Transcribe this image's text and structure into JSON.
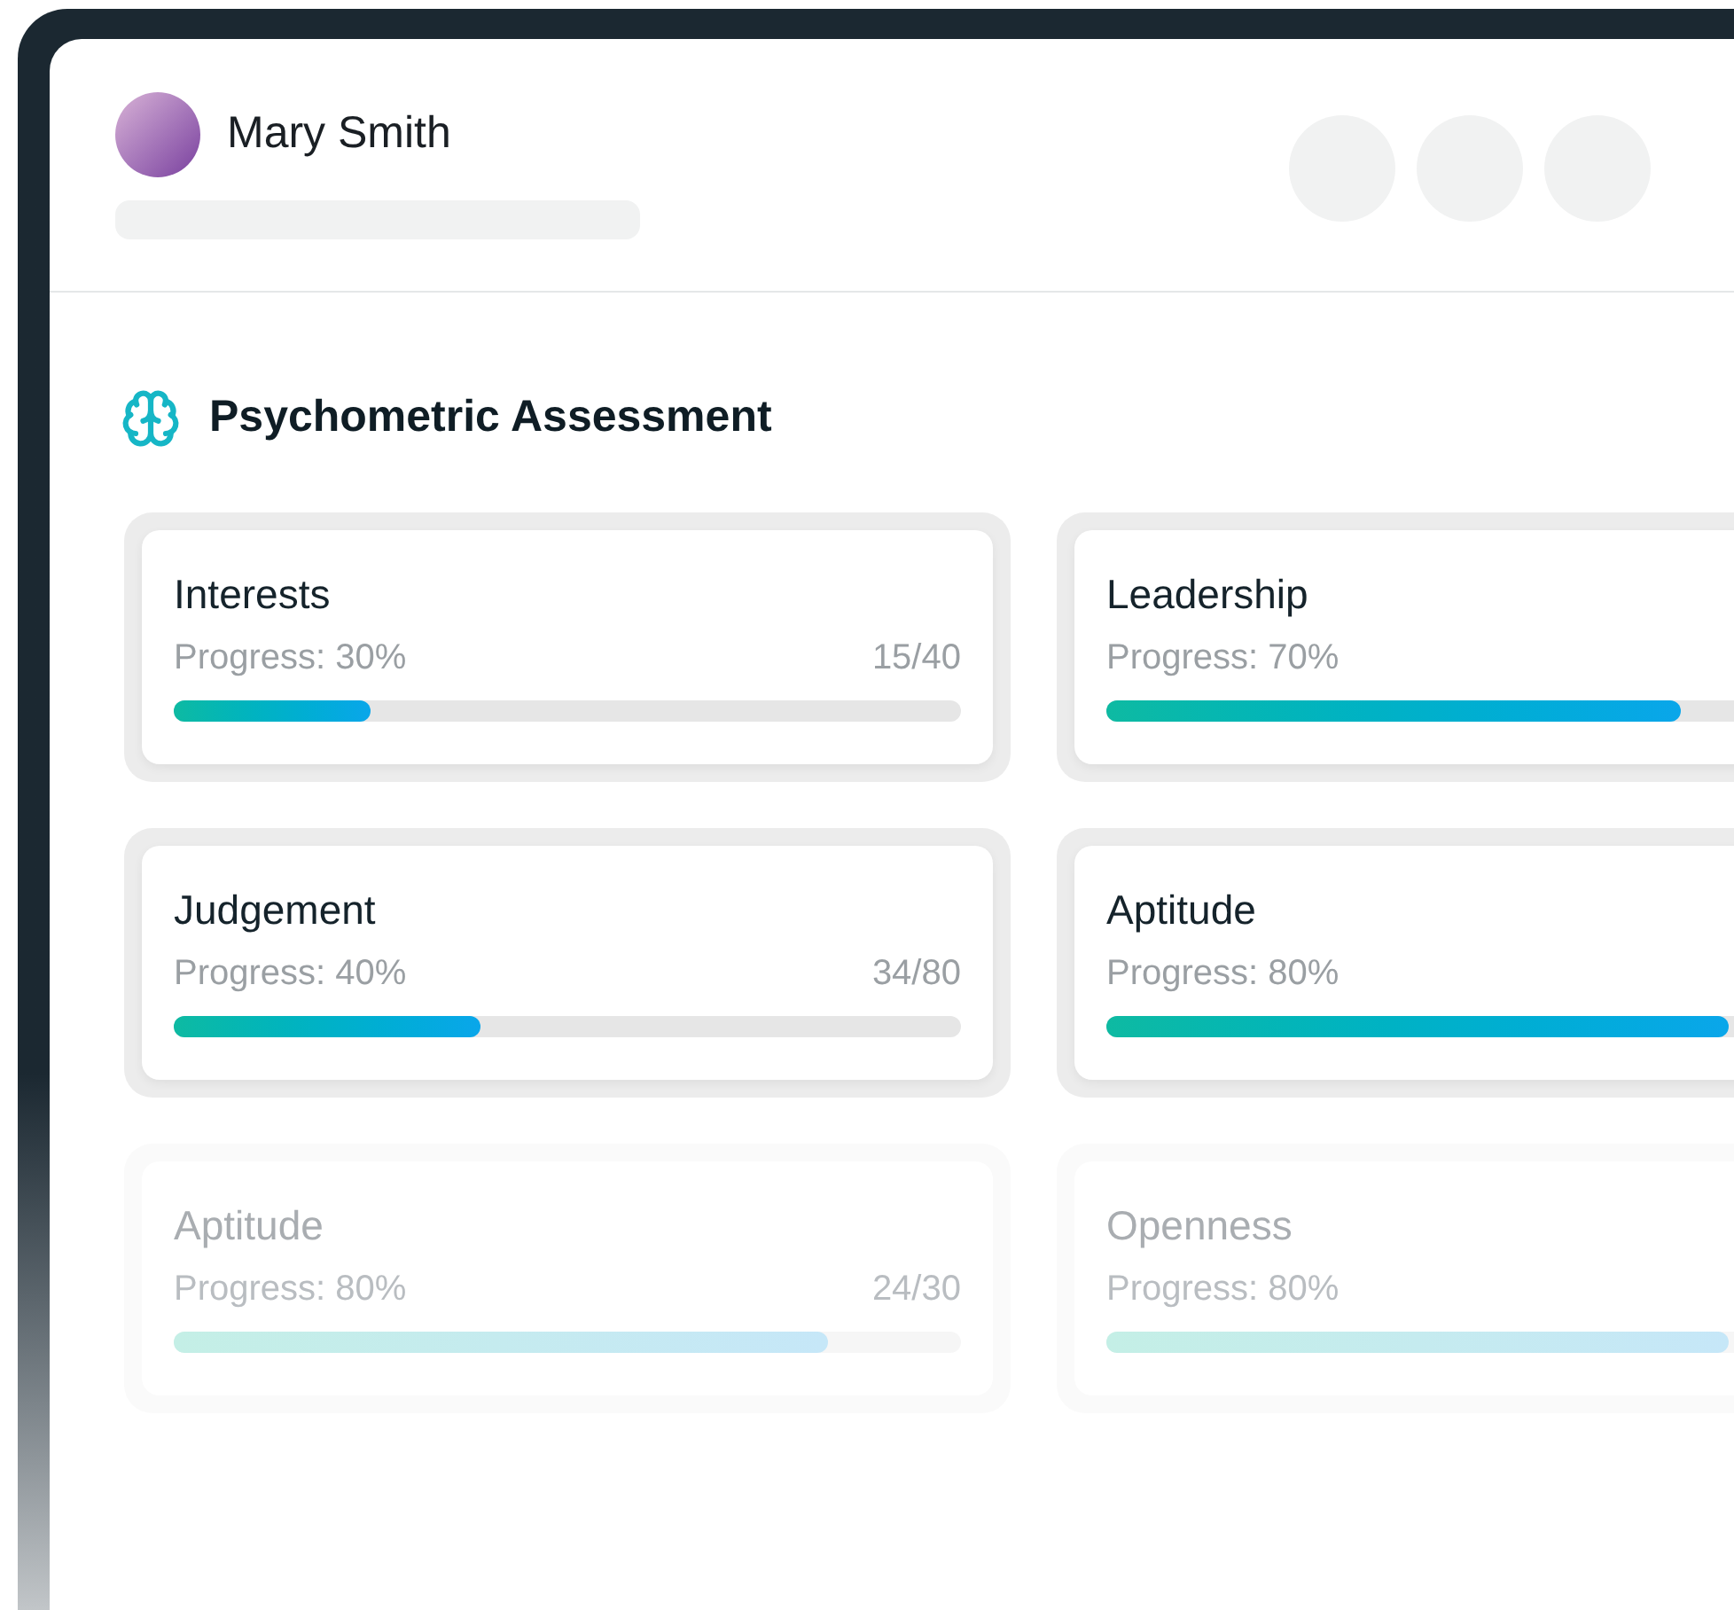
{
  "profile": {
    "name": "Mary Smith"
  },
  "section": {
    "title": "Psychometric Assessment"
  },
  "cards": [
    {
      "title": "Interests",
      "progress": "Progress: 30%",
      "count": "15/40",
      "level": 0.25,
      "faded": false
    },
    {
      "title": "Leadership",
      "progress": "Progress: 70%",
      "level": 0.73,
      "faded": false
    },
    {
      "title": "Judgement",
      "progress": "Progress: 40%",
      "count": "34/80",
      "level": 0.39,
      "faded": false
    },
    {
      "title": "Aptitude",
      "progress": "Progress: 80%",
      "level": 0.79,
      "faded": false
    },
    {
      "title": "Aptitude",
      "progress": "Progress: 80%",
      "count": "24/30",
      "level": 0.83,
      "faded": true
    },
    {
      "title": "Openness",
      "progress": "Progress: 80%",
      "level": 0.79,
      "faded": true
    }
  ]
}
